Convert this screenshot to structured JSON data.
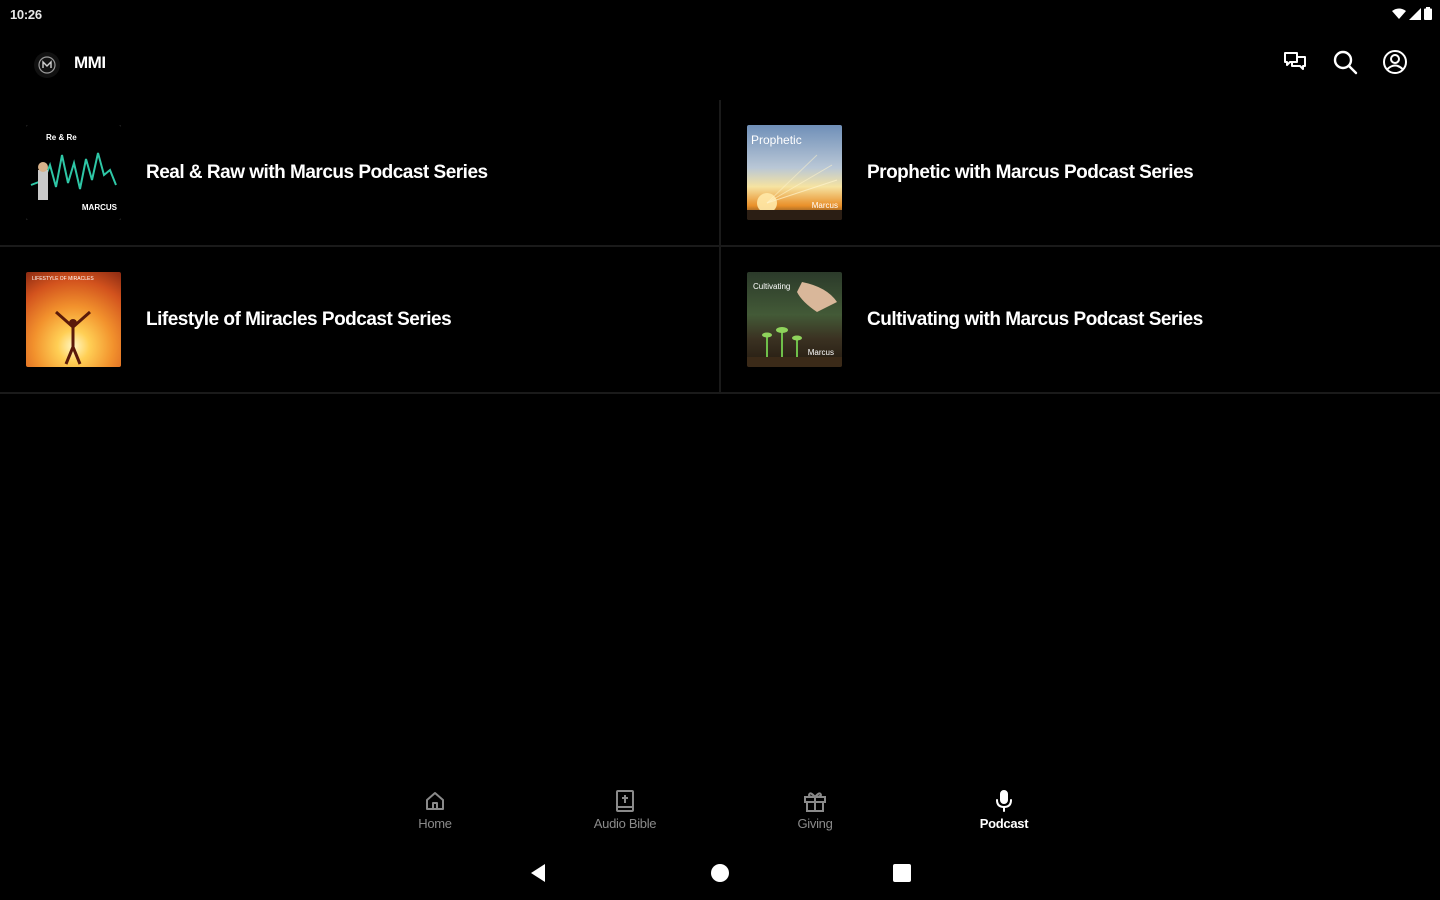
{
  "status_bar": {
    "time": "10:26",
    "icons": [
      "wifi-icon",
      "cell-signal-icon",
      "battery-icon"
    ]
  },
  "app_bar": {
    "title": "MMI",
    "logo_icon": "app-logo-icon",
    "actions": [
      {
        "icon": "chat-icon"
      },
      {
        "icon": "search-icon"
      },
      {
        "icon": "account-icon"
      }
    ]
  },
  "podcasts": [
    {
      "title": "Real & Raw with Marcus Podcast Series",
      "art": {
        "top": "Re & Re",
        "bottom": "MARCUS"
      }
    },
    {
      "title": "Prophetic with Marcus Podcast Series",
      "art": {
        "top": "Prophetic",
        "bottom": "Marcus"
      }
    },
    {
      "title": "Lifestyle of Miracles Podcast Series",
      "art": {
        "top": "LIFESTYLE OF MIRACLES",
        "bottom": ""
      }
    },
    {
      "title": "Cultivating with Marcus Podcast Series",
      "art": {
        "top": "Cultivating",
        "bottom": "Marcus"
      }
    }
  ],
  "bottom_nav": {
    "items": [
      {
        "label": "Home",
        "icon": "home-icon",
        "active": false
      },
      {
        "label": "Audio Bible",
        "icon": "bible-icon",
        "active": false
      },
      {
        "label": "Giving",
        "icon": "gift-icon",
        "active": false
      },
      {
        "label": "Podcast",
        "icon": "microphone-icon",
        "active": true
      }
    ]
  },
  "system_nav": [
    "back-icon",
    "home-circle-icon",
    "recents-icon"
  ],
  "colors": {
    "background": "#000000",
    "text": "#ffffff",
    "inactive": "#8a8a8a",
    "divider": "#1a1a1a"
  }
}
